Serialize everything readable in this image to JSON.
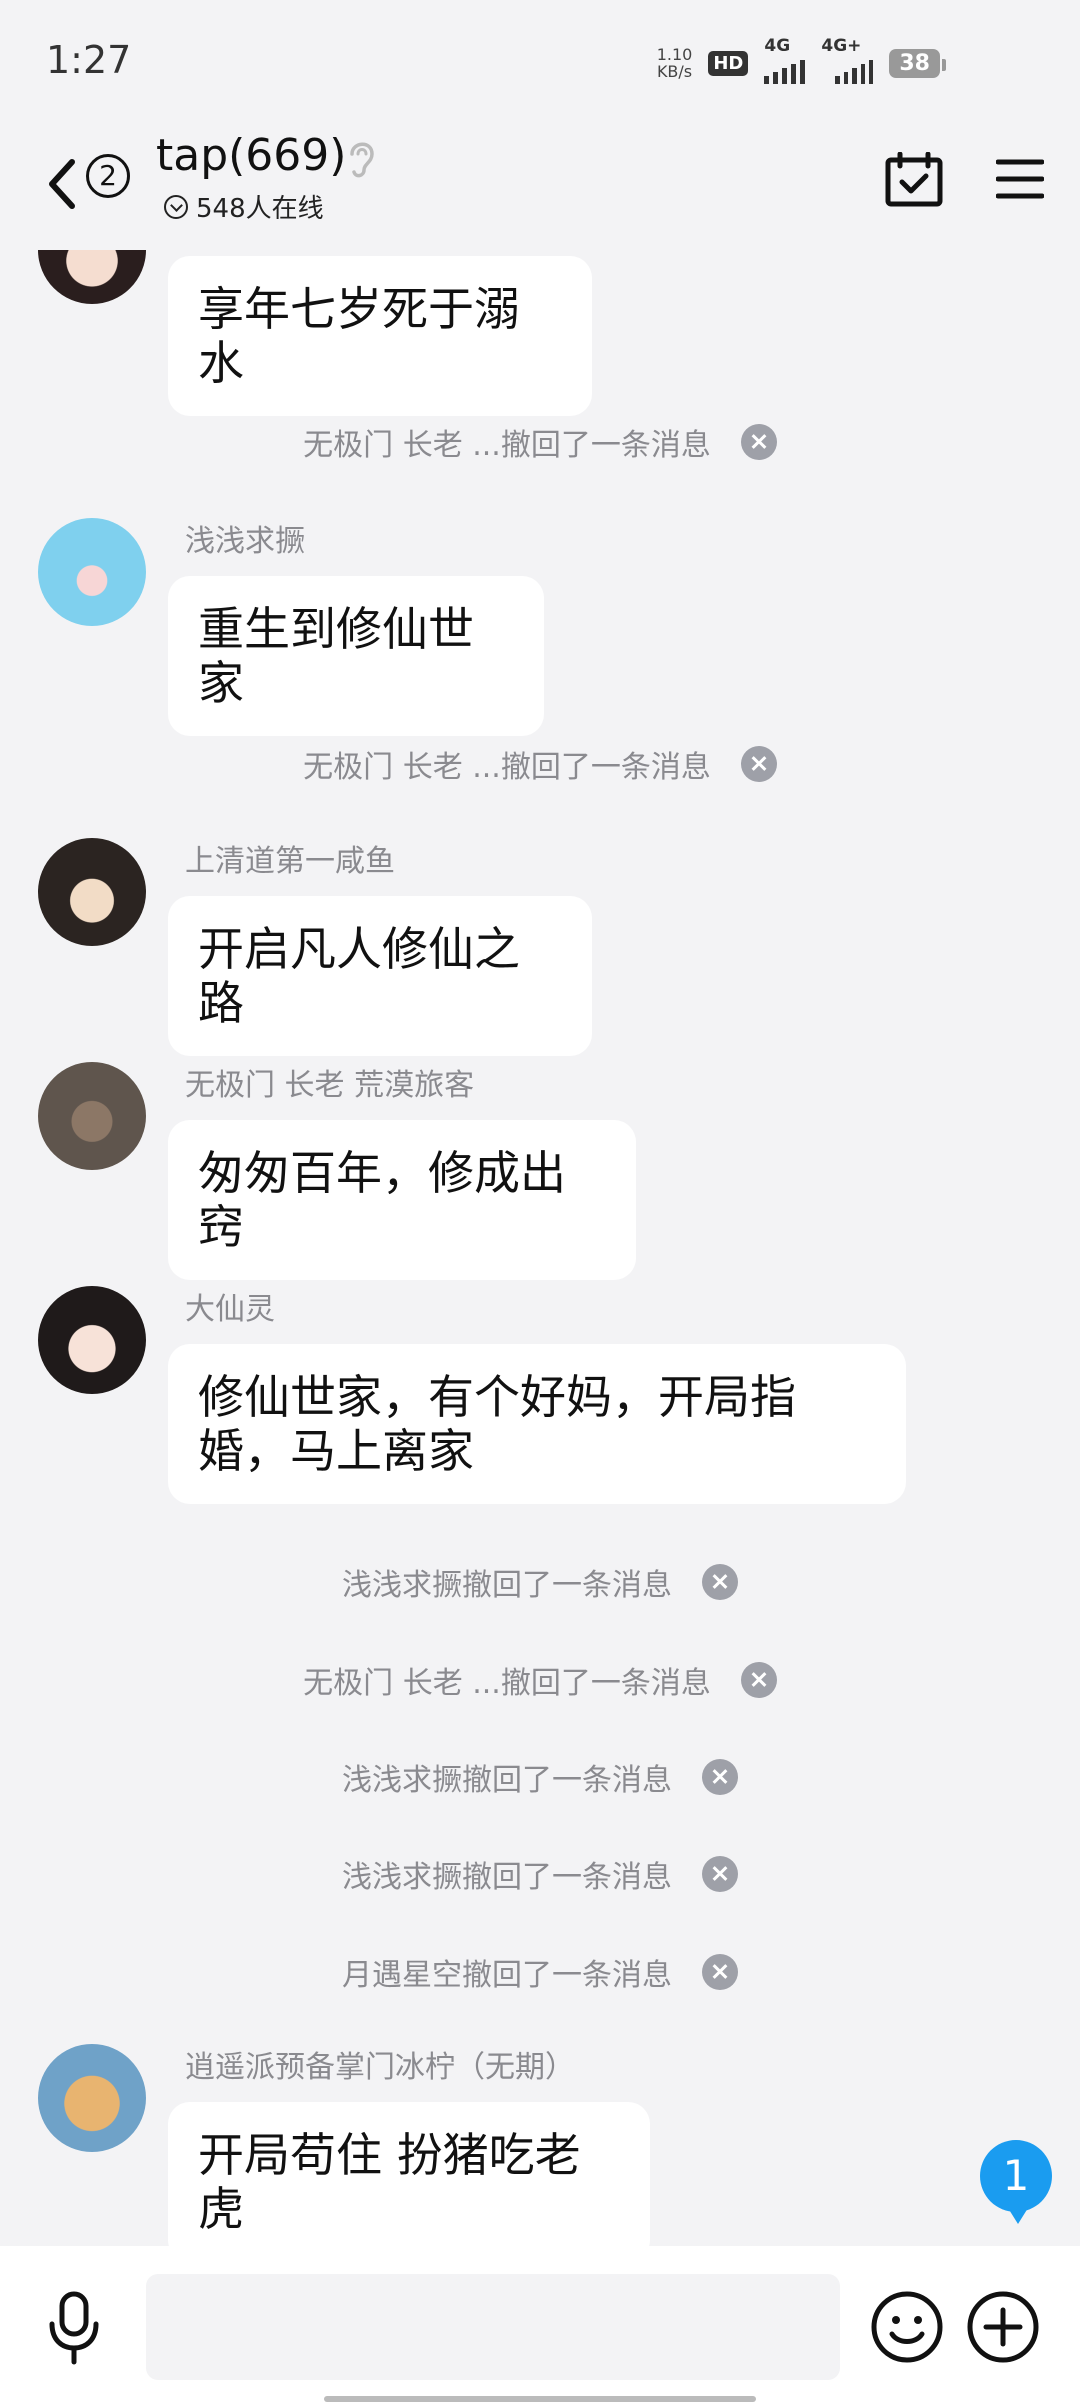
{
  "status_bar": {
    "time": "1:27",
    "net_speed_value": "1.10",
    "net_speed_unit": "KB/s",
    "hd_label": "HD",
    "sim1_label": "4G",
    "sim2_label": "4G+",
    "battery": "38"
  },
  "header": {
    "back_count": "2",
    "title": "tap(669)",
    "online": "548人在线"
  },
  "messages": [
    {
      "text": "享年七岁死于溺水"
    },
    {
      "system": "无极门  长老 ...撤回了一条消息"
    },
    {
      "sender": "浅浅求撅",
      "text": "重生到修仙世家"
    },
    {
      "system": "无极门  长老 ...撤回了一条消息"
    },
    {
      "sender": "上清道第一咸鱼",
      "text": "开启凡人修仙之路"
    },
    {
      "sender": "无极门  长老   荒漠旅客",
      "text": "匆匆百年，修成出窍"
    },
    {
      "sender": "大仙灵",
      "text": "修仙世家，有个好妈，开局指婚，马上离家"
    },
    {
      "system": "浅浅求撅撤回了一条消息"
    },
    {
      "system": "无极门  长老 ...撤回了一条消息"
    },
    {
      "system": "浅浅求撅撤回了一条消息"
    },
    {
      "system": "浅浅求撅撤回了一条消息"
    },
    {
      "system": "月遇星空撤回了一条消息"
    },
    {
      "sender": "逍遥派预备掌门冰柠（无期）",
      "text": "开局苟住 扮猪吃老虎"
    }
  ],
  "unread_count": "1",
  "input": {
    "placeholder": ""
  },
  "colors": {
    "accent": "#1a9cf0",
    "background": "#f3f3f5",
    "bubble": "#ffffff",
    "muted_text": "#8a8a8f"
  }
}
